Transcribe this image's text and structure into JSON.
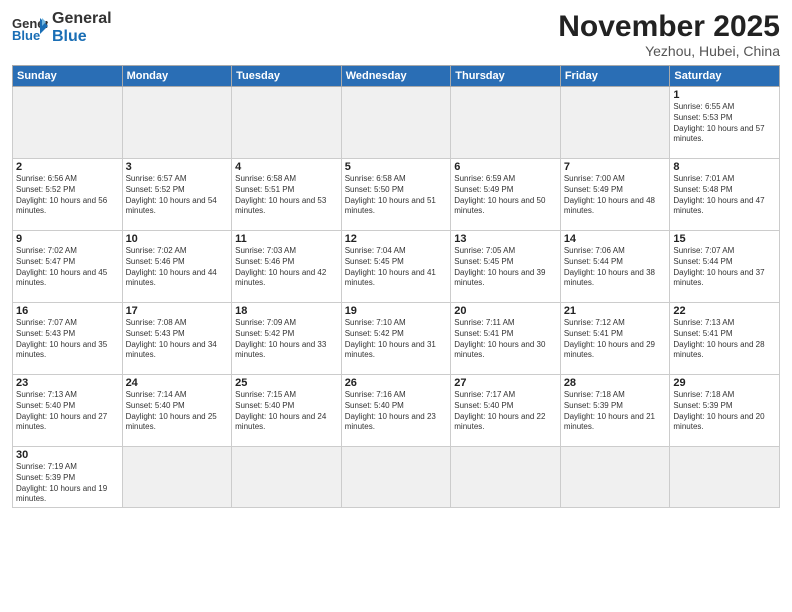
{
  "header": {
    "logo_general": "General",
    "logo_blue": "Blue",
    "month": "November 2025",
    "location": "Yezhou, Hubei, China"
  },
  "weekdays": [
    "Sunday",
    "Monday",
    "Tuesday",
    "Wednesday",
    "Thursday",
    "Friday",
    "Saturday"
  ],
  "weeks": [
    [
      null,
      null,
      null,
      null,
      null,
      null,
      {
        "day": "1",
        "sunrise": "6:55 AM",
        "sunset": "5:53 PM",
        "daylight": "10 hours and 57 minutes."
      }
    ],
    [
      {
        "day": "2",
        "sunrise": "6:56 AM",
        "sunset": "5:52 PM",
        "daylight": "10 hours and 56 minutes."
      },
      {
        "day": "3",
        "sunrise": "6:57 AM",
        "sunset": "5:52 PM",
        "daylight": "10 hours and 54 minutes."
      },
      {
        "day": "4",
        "sunrise": "6:58 AM",
        "sunset": "5:51 PM",
        "daylight": "10 hours and 53 minutes."
      },
      {
        "day": "5",
        "sunrise": "6:58 AM",
        "sunset": "5:50 PM",
        "daylight": "10 hours and 51 minutes."
      },
      {
        "day": "6",
        "sunrise": "6:59 AM",
        "sunset": "5:49 PM",
        "daylight": "10 hours and 50 minutes."
      },
      {
        "day": "7",
        "sunrise": "7:00 AM",
        "sunset": "5:49 PM",
        "daylight": "10 hours and 48 minutes."
      },
      {
        "day": "8",
        "sunrise": "7:01 AM",
        "sunset": "5:48 PM",
        "daylight": "10 hours and 47 minutes."
      }
    ],
    [
      {
        "day": "9",
        "sunrise": "7:02 AM",
        "sunset": "5:47 PM",
        "daylight": "10 hours and 45 minutes."
      },
      {
        "day": "10",
        "sunrise": "7:02 AM",
        "sunset": "5:46 PM",
        "daylight": "10 hours and 44 minutes."
      },
      {
        "day": "11",
        "sunrise": "7:03 AM",
        "sunset": "5:46 PM",
        "daylight": "10 hours and 42 minutes."
      },
      {
        "day": "12",
        "sunrise": "7:04 AM",
        "sunset": "5:45 PM",
        "daylight": "10 hours and 41 minutes."
      },
      {
        "day": "13",
        "sunrise": "7:05 AM",
        "sunset": "5:45 PM",
        "daylight": "10 hours and 39 minutes."
      },
      {
        "day": "14",
        "sunrise": "7:06 AM",
        "sunset": "5:44 PM",
        "daylight": "10 hours and 38 minutes."
      },
      {
        "day": "15",
        "sunrise": "7:07 AM",
        "sunset": "5:44 PM",
        "daylight": "10 hours and 37 minutes."
      }
    ],
    [
      {
        "day": "16",
        "sunrise": "7:07 AM",
        "sunset": "5:43 PM",
        "daylight": "10 hours and 35 minutes."
      },
      {
        "day": "17",
        "sunrise": "7:08 AM",
        "sunset": "5:43 PM",
        "daylight": "10 hours and 34 minutes."
      },
      {
        "day": "18",
        "sunrise": "7:09 AM",
        "sunset": "5:42 PM",
        "daylight": "10 hours and 33 minutes."
      },
      {
        "day": "19",
        "sunrise": "7:10 AM",
        "sunset": "5:42 PM",
        "daylight": "10 hours and 31 minutes."
      },
      {
        "day": "20",
        "sunrise": "7:11 AM",
        "sunset": "5:41 PM",
        "daylight": "10 hours and 30 minutes."
      },
      {
        "day": "21",
        "sunrise": "7:12 AM",
        "sunset": "5:41 PM",
        "daylight": "10 hours and 29 minutes."
      },
      {
        "day": "22",
        "sunrise": "7:13 AM",
        "sunset": "5:41 PM",
        "daylight": "10 hours and 28 minutes."
      }
    ],
    [
      {
        "day": "23",
        "sunrise": "7:13 AM",
        "sunset": "5:40 PM",
        "daylight": "10 hours and 27 minutes."
      },
      {
        "day": "24",
        "sunrise": "7:14 AM",
        "sunset": "5:40 PM",
        "daylight": "10 hours and 25 minutes."
      },
      {
        "day": "25",
        "sunrise": "7:15 AM",
        "sunset": "5:40 PM",
        "daylight": "10 hours and 24 minutes."
      },
      {
        "day": "26",
        "sunrise": "7:16 AM",
        "sunset": "5:40 PM",
        "daylight": "10 hours and 23 minutes."
      },
      {
        "day": "27",
        "sunrise": "7:17 AM",
        "sunset": "5:40 PM",
        "daylight": "10 hours and 22 minutes."
      },
      {
        "day": "28",
        "sunrise": "7:18 AM",
        "sunset": "5:39 PM",
        "daylight": "10 hours and 21 minutes."
      },
      {
        "day": "29",
        "sunrise": "7:18 AM",
        "sunset": "5:39 PM",
        "daylight": "10 hours and 20 minutes."
      }
    ],
    [
      {
        "day": "30",
        "sunrise": "7:19 AM",
        "sunset": "5:39 PM",
        "daylight": "10 hours and 19 minutes."
      },
      null,
      null,
      null,
      null,
      null,
      null
    ]
  ]
}
